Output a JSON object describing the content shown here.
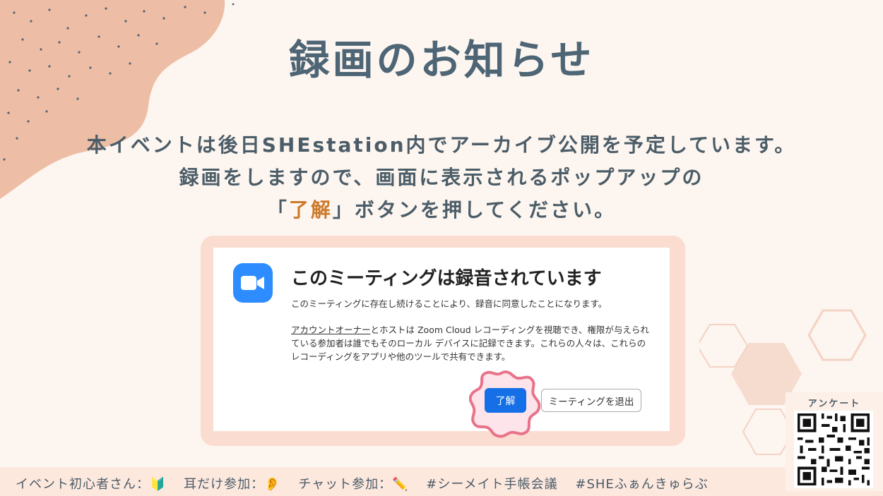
{
  "slide": {
    "title": "録画のお知らせ",
    "message_line1": "本イベントは後日SHEstation内でアーカイブ公開を予定しています。",
    "message_line2": "録画をしますので、画面に表示されるポップアップの",
    "message_line3_open": "「",
    "message_line3_accent": "了解",
    "message_line3_rest": "」ボタンを押してください。"
  },
  "dialog": {
    "title": "このミーティングは録音されています",
    "text1": "このミーティングに存在し続けることにより、録音に同意したことになります。",
    "text2_link": "アカウントオーナー",
    "text2_rest": "とホストは Zoom Cloud レコーディングを視聴でき、権限が与えられている参加者は誰でもそのローカル デバイスに記録できます。これらの人々は、これらのレコーディングをアプリや他のツールで共有できます。",
    "ok_button": "了解",
    "leave_button": "ミーティングを退出"
  },
  "footer": {
    "item1": "イベント初心者さん：🔰",
    "item2": "耳だけ参加：👂",
    "item3": "チャット参加：✏️",
    "item4": "#シーメイト手帳会議",
    "item5": "#SHEふぁんきゅらぶ"
  },
  "qr": {
    "label": "アンケート"
  },
  "colors": {
    "background": "#fdf5ef",
    "accent": "#cc7a2c",
    "zoom_blue": "#2d8cff",
    "button_blue": "#1570e8"
  }
}
